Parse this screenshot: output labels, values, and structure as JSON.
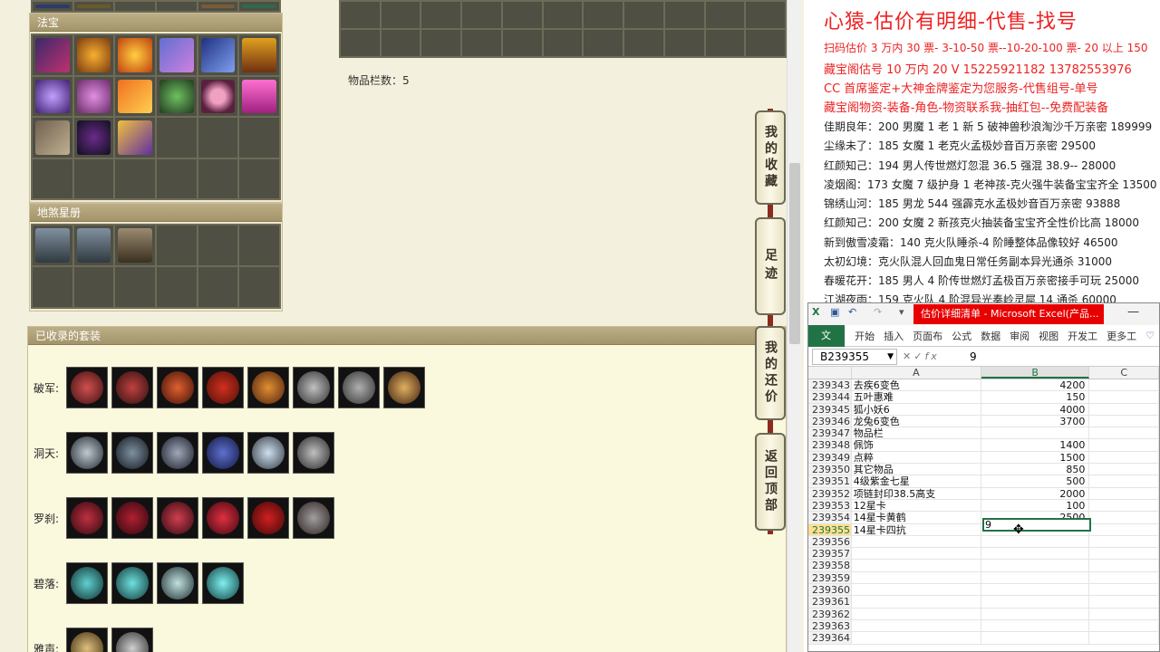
{
  "left": {
    "magic_header": "法宝",
    "star_header": "地煞星册",
    "item_count": "物品栏数：5",
    "suits_header": "已收录的套装",
    "suits": [
      {
        "name": "破军:",
        "count": 8
      },
      {
        "name": "洞天:",
        "count": 6
      },
      {
        "name": "罗刹:",
        "count": 6
      },
      {
        "name": "碧落:",
        "count": 4
      },
      {
        "name": "雅声:",
        "count": 2
      }
    ],
    "side_buttons": [
      {
        "label": "我的收藏"
      },
      {
        "label": "足迹"
      },
      {
        "label": "我的还价"
      },
      {
        "label": "返回顶部"
      }
    ]
  },
  "info": {
    "title": "心猿-估价有明细-代售-找号",
    "lines": [
      {
        "text": "扫码估价 3 万内 30 票- 3-10-50 票--10-20-100 票- 20 以上 150",
        "style": "red"
      },
      {
        "text": "藏宝阁估号 10 万内 20 V 15225921182   13782553976",
        "style": "red"
      },
      {
        "text": "CC 首席鉴定+大神金牌鉴定为您服务-代售组号-单号",
        "style": "red"
      },
      {
        "text": "藏宝阁物资-装备-角色-物资联系我-抽红包--免费配装备",
        "style": "red"
      },
      {
        "text": "佳期良年：200 男魔 1 老 1 新 5 破神兽秒浪淘沙千万亲密 189999",
        "style": "dark"
      },
      {
        "text": "尘缘未了：185 女魔 1 老克火孟极妙音百万亲密 29500",
        "style": "dark"
      },
      {
        "text": "红颜知己：194 男人传世燃灯忽混 36.5 强混 38.9-- 28000",
        "style": "dark"
      },
      {
        "text": "凌烟阁：173 女魔 7 级护身 1 老神孩-克火强牛装备宝宝齐全 13500",
        "style": "dark"
      },
      {
        "text": "锦绣山河：185 男龙 544 强霹克水孟极妙音百万亲密 93888",
        "style": "dark"
      },
      {
        "text": "红颜知己：200 女魔 2 新孩克火抽装备宝宝齐全性价比高 18000",
        "style": "dark"
      },
      {
        "text": "新到傲雪凌霜：140 克火队睡杀-4 阶睡整体品像较好 46500",
        "style": "dark"
      },
      {
        "text": "太初幻境：克火队混人回血鬼日常任务副本异光通杀 31000",
        "style": "dark"
      },
      {
        "text": "春暖花开：185 男人 4 阶传世燃灯孟极百万亲密接手可玩 25000",
        "style": "dark"
      },
      {
        "text": "江湖夜雨：159 克火队 4 阶混异光奏岭灵犀 14 通杀 60000",
        "style": "dark"
      }
    ]
  },
  "excel": {
    "title": "估价详细清单 - Microsoft Excel(产品...",
    "tabs": [
      "开始",
      "插入",
      "页面布",
      "公式",
      "数据",
      "审阅",
      "视图",
      "开发工",
      "更多工"
    ],
    "file_tab": "文件",
    "name_box": "B239355",
    "formula_value": "9",
    "columns": [
      "A",
      "B",
      "C"
    ],
    "rows": [
      {
        "num": "239343",
        "a": "去疾6变色",
        "b": "4200"
      },
      {
        "num": "239344",
        "a": "五叶惠难",
        "b": "150"
      },
      {
        "num": "239345",
        "a": "狐小妖6",
        "b": "4000"
      },
      {
        "num": "239346",
        "a": "龙兔6变色",
        "b": "3700"
      },
      {
        "num": "239347",
        "a": "物品栏",
        "b": ""
      },
      {
        "num": "239348",
        "a": "佩饰",
        "b": "1400"
      },
      {
        "num": "239349",
        "a": "点粹",
        "b": "1500"
      },
      {
        "num": "239350",
        "a": "其它物品",
        "b": "850"
      },
      {
        "num": "239351",
        "a": "4级紫金七星",
        "b": "500"
      },
      {
        "num": "239352",
        "a": "项链封印38.5高支",
        "b": "2000"
      },
      {
        "num": "239353",
        "a": "12星卡",
        "b": "100"
      },
      {
        "num": "239354",
        "a": "14星卡黄鹤",
        "b": "2500"
      },
      {
        "num": "239355",
        "a": "14星卡四抗",
        "b": ""
      },
      {
        "num": "239356",
        "a": "",
        "b": ""
      },
      {
        "num": "239357",
        "a": "",
        "b": ""
      },
      {
        "num": "239358",
        "a": "",
        "b": ""
      },
      {
        "num": "239359",
        "a": "",
        "b": ""
      },
      {
        "num": "239360",
        "a": "",
        "b": ""
      },
      {
        "num": "239361",
        "a": "",
        "b": ""
      },
      {
        "num": "239362",
        "a": "",
        "b": ""
      },
      {
        "num": "239363",
        "a": "",
        "b": ""
      },
      {
        "num": "239364",
        "a": "",
        "b": ""
      }
    ],
    "active_value": "9"
  }
}
